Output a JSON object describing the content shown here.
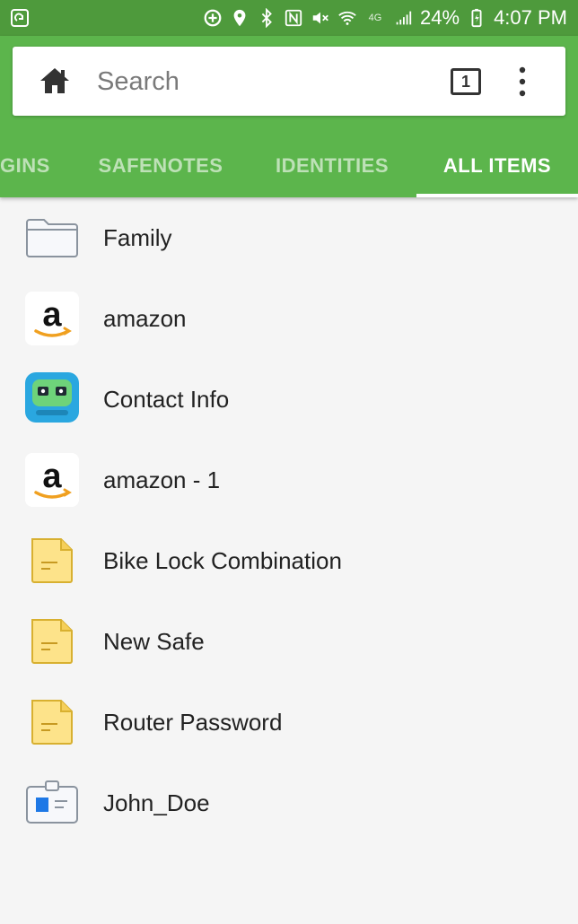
{
  "status_bar": {
    "battery": "24%",
    "time": "4:07 PM",
    "network": "4G"
  },
  "search": {
    "placeholder": "Search",
    "tab_count": "1"
  },
  "tabs": [
    {
      "label": "GINS",
      "active": false
    },
    {
      "label": "SAFENOTES",
      "active": false
    },
    {
      "label": "IDENTITIES",
      "active": false
    },
    {
      "label": "ALL ITEMS",
      "active": true
    }
  ],
  "items": [
    {
      "label": "Family",
      "icon": "folder-icon"
    },
    {
      "label": "amazon",
      "icon": "amazon-icon"
    },
    {
      "label": "Contact Info",
      "icon": "robot-icon"
    },
    {
      "label": "amazon - 1",
      "icon": "amazon-icon"
    },
    {
      "label": "Bike Lock Combination",
      "icon": "note-icon"
    },
    {
      "label": "New Safe",
      "icon": "note-icon"
    },
    {
      "label": "Router Password",
      "icon": "note-icon"
    },
    {
      "label": "John_Doe",
      "icon": "id-card-icon"
    }
  ],
  "colors": {
    "status_bar": "#4e9a3c",
    "app_bar": "#5cb54c",
    "background": "#f5f5f5"
  }
}
